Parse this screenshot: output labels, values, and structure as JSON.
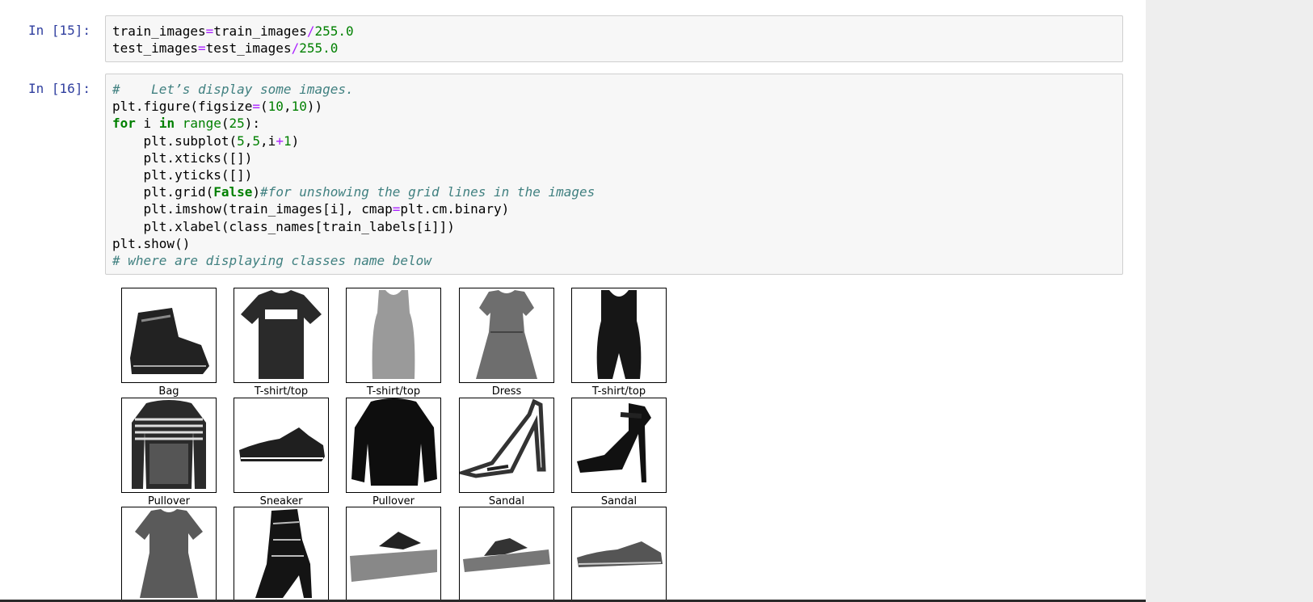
{
  "cells": [
    {
      "prompt": "In [15]:",
      "lines": [
        [
          [
            "",
            "train_images"
          ],
          [
            "o",
            "="
          ],
          [
            "",
            "train_images"
          ],
          [
            "o",
            "/"
          ],
          [
            "n",
            "255.0"
          ]
        ],
        [
          [
            "",
            "test_images"
          ],
          [
            "o",
            "="
          ],
          [
            "",
            "test_images"
          ],
          [
            "o",
            "/"
          ],
          [
            "n",
            "255.0"
          ]
        ]
      ]
    },
    {
      "prompt": "In [16]:",
      "lines": [
        [
          [
            "c",
            "#    Let’s display some images."
          ]
        ],
        [
          [
            "",
            "plt.figure(figsize"
          ],
          [
            "o",
            "="
          ],
          [
            "",
            "("
          ],
          [
            "n",
            "10"
          ],
          [
            "",
            ","
          ],
          [
            "n",
            "10"
          ],
          [
            "",
            "))"
          ]
        ],
        [
          [
            "k",
            "for"
          ],
          [
            "",
            " i "
          ],
          [
            "k",
            "in"
          ],
          [
            "",
            " "
          ],
          [
            "b",
            "range"
          ],
          [
            "",
            "("
          ],
          [
            "n",
            "25"
          ],
          [
            "",
            "):"
          ]
        ],
        [
          [
            "",
            "    plt.subplot("
          ],
          [
            "n",
            "5"
          ],
          [
            "",
            ","
          ],
          [
            "n",
            "5"
          ],
          [
            "",
            ",i"
          ],
          [
            "o",
            "+"
          ],
          [
            "n",
            "1"
          ],
          [
            "",
            ")"
          ]
        ],
        [
          [
            "",
            "    plt.xticks([])"
          ]
        ],
        [
          [
            "",
            "    plt.yticks([])"
          ]
        ],
        [
          [
            "",
            "    plt.grid("
          ],
          [
            "k",
            "False"
          ],
          [
            "",
            ")"
          ],
          [
            "c",
            "#for unshowing the grid lines in the images"
          ]
        ],
        [
          [
            "",
            "    plt.imshow(train_images[i], cmap"
          ],
          [
            "o",
            "="
          ],
          [
            "",
            "plt.cm.binary)"
          ]
        ],
        [
          [
            "",
            "    plt.xlabel(class_names[train_labels[i]])"
          ]
        ],
        [
          [
            "",
            "plt.show()"
          ]
        ],
        [
          [
            "c",
            "# where are displaying classes name below"
          ]
        ]
      ]
    }
  ],
  "output": {
    "images": [
      {
        "label": "Bag",
        "icon": "ankle-boot-icon"
      },
      {
        "label": "T-shirt/top",
        "icon": "tshirt-icon"
      },
      {
        "label": "T-shirt/top",
        "icon": "tank-top-icon"
      },
      {
        "label": "Dress",
        "icon": "dress-icon"
      },
      {
        "label": "T-shirt/top",
        "icon": "tank-top-dark-icon"
      },
      {
        "label": "Pullover",
        "icon": "striped-pullover-icon"
      },
      {
        "label": "Sneaker",
        "icon": "sneaker-icon"
      },
      {
        "label": "Pullover",
        "icon": "pullover-icon"
      },
      {
        "label": "Sandal",
        "icon": "high-heel-sandal-icon"
      },
      {
        "label": "Sandal",
        "icon": "heel-sandal-dark-icon"
      },
      {
        "label": "",
        "icon": "dress-short-icon"
      },
      {
        "label": "",
        "icon": "heeled-boot-icon"
      },
      {
        "label": "",
        "icon": "wedge-sandal-icon"
      },
      {
        "label": "",
        "icon": "flat-sandal-icon"
      },
      {
        "label": "",
        "icon": "low-sneaker-icon"
      }
    ]
  },
  "colors": {
    "prompt": "#303f9f",
    "keyword": "#008000",
    "operator": "#aa22ff",
    "comment": "#408080",
    "cell_bg": "#f7f7f7",
    "side_panel": "#eeeeee"
  }
}
